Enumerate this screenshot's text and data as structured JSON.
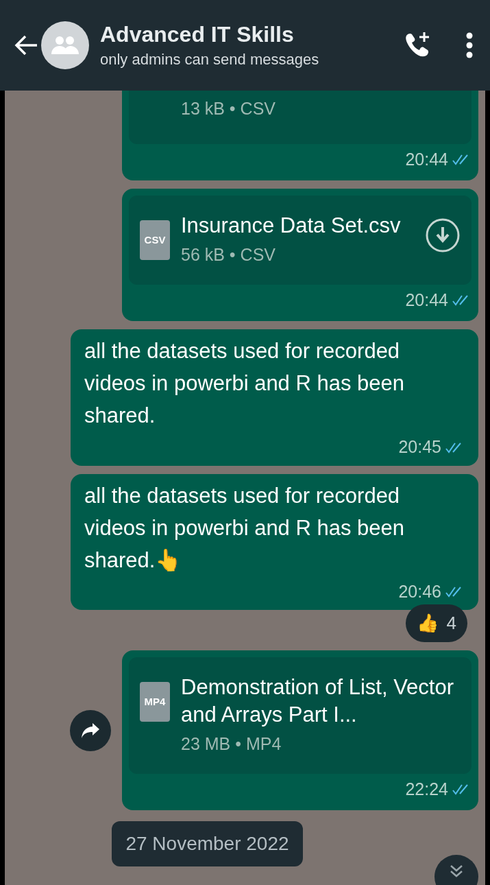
{
  "header": {
    "title": "Advanced IT Skills",
    "subtitle": "only admins can send messages"
  },
  "messages": [
    {
      "kind": "document",
      "cut": true,
      "meta": "13 kB • CSV",
      "time": "20:44",
      "read": true,
      "download": false
    },
    {
      "kind": "document",
      "cut": false,
      "file_type": "CSV",
      "name": "Insurance Data Set.csv",
      "meta": "56 kB • CSV",
      "time": "20:44",
      "read": true,
      "download": true
    },
    {
      "kind": "text",
      "text": "all the datasets used for recorded videos in powerbi and R has been shared.",
      "time": "20:45",
      "read": true
    },
    {
      "kind": "text",
      "text": "all the datasets used for recorded videos in powerbi and R has been shared.👆",
      "time": "20:46",
      "read": true,
      "reaction": {
        "emoji": "👍",
        "count": "4"
      }
    },
    {
      "kind": "video",
      "cut": false,
      "file_type": "MP4",
      "name": "Demonstration of List, Vector and Arrays Part I...",
      "meta": "23 MB • MP4",
      "time": "22:24",
      "read": true,
      "download": false
    }
  ],
  "date_chip": "27 November 2022"
}
